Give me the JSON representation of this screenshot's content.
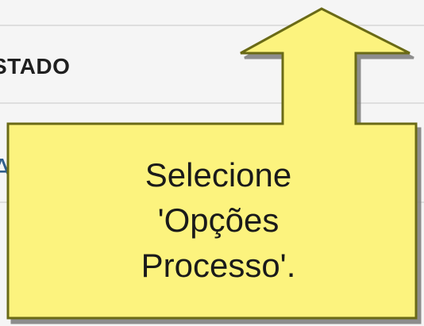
{
  "table": {
    "column_header": "STADO",
    "cell_fragment": "A"
  },
  "callout": {
    "lines": [
      "Selecione",
      "'Opções",
      "Processo'."
    ],
    "fill_color": "#fcf37e",
    "border_color": "#6a6a14",
    "direction": "up"
  }
}
